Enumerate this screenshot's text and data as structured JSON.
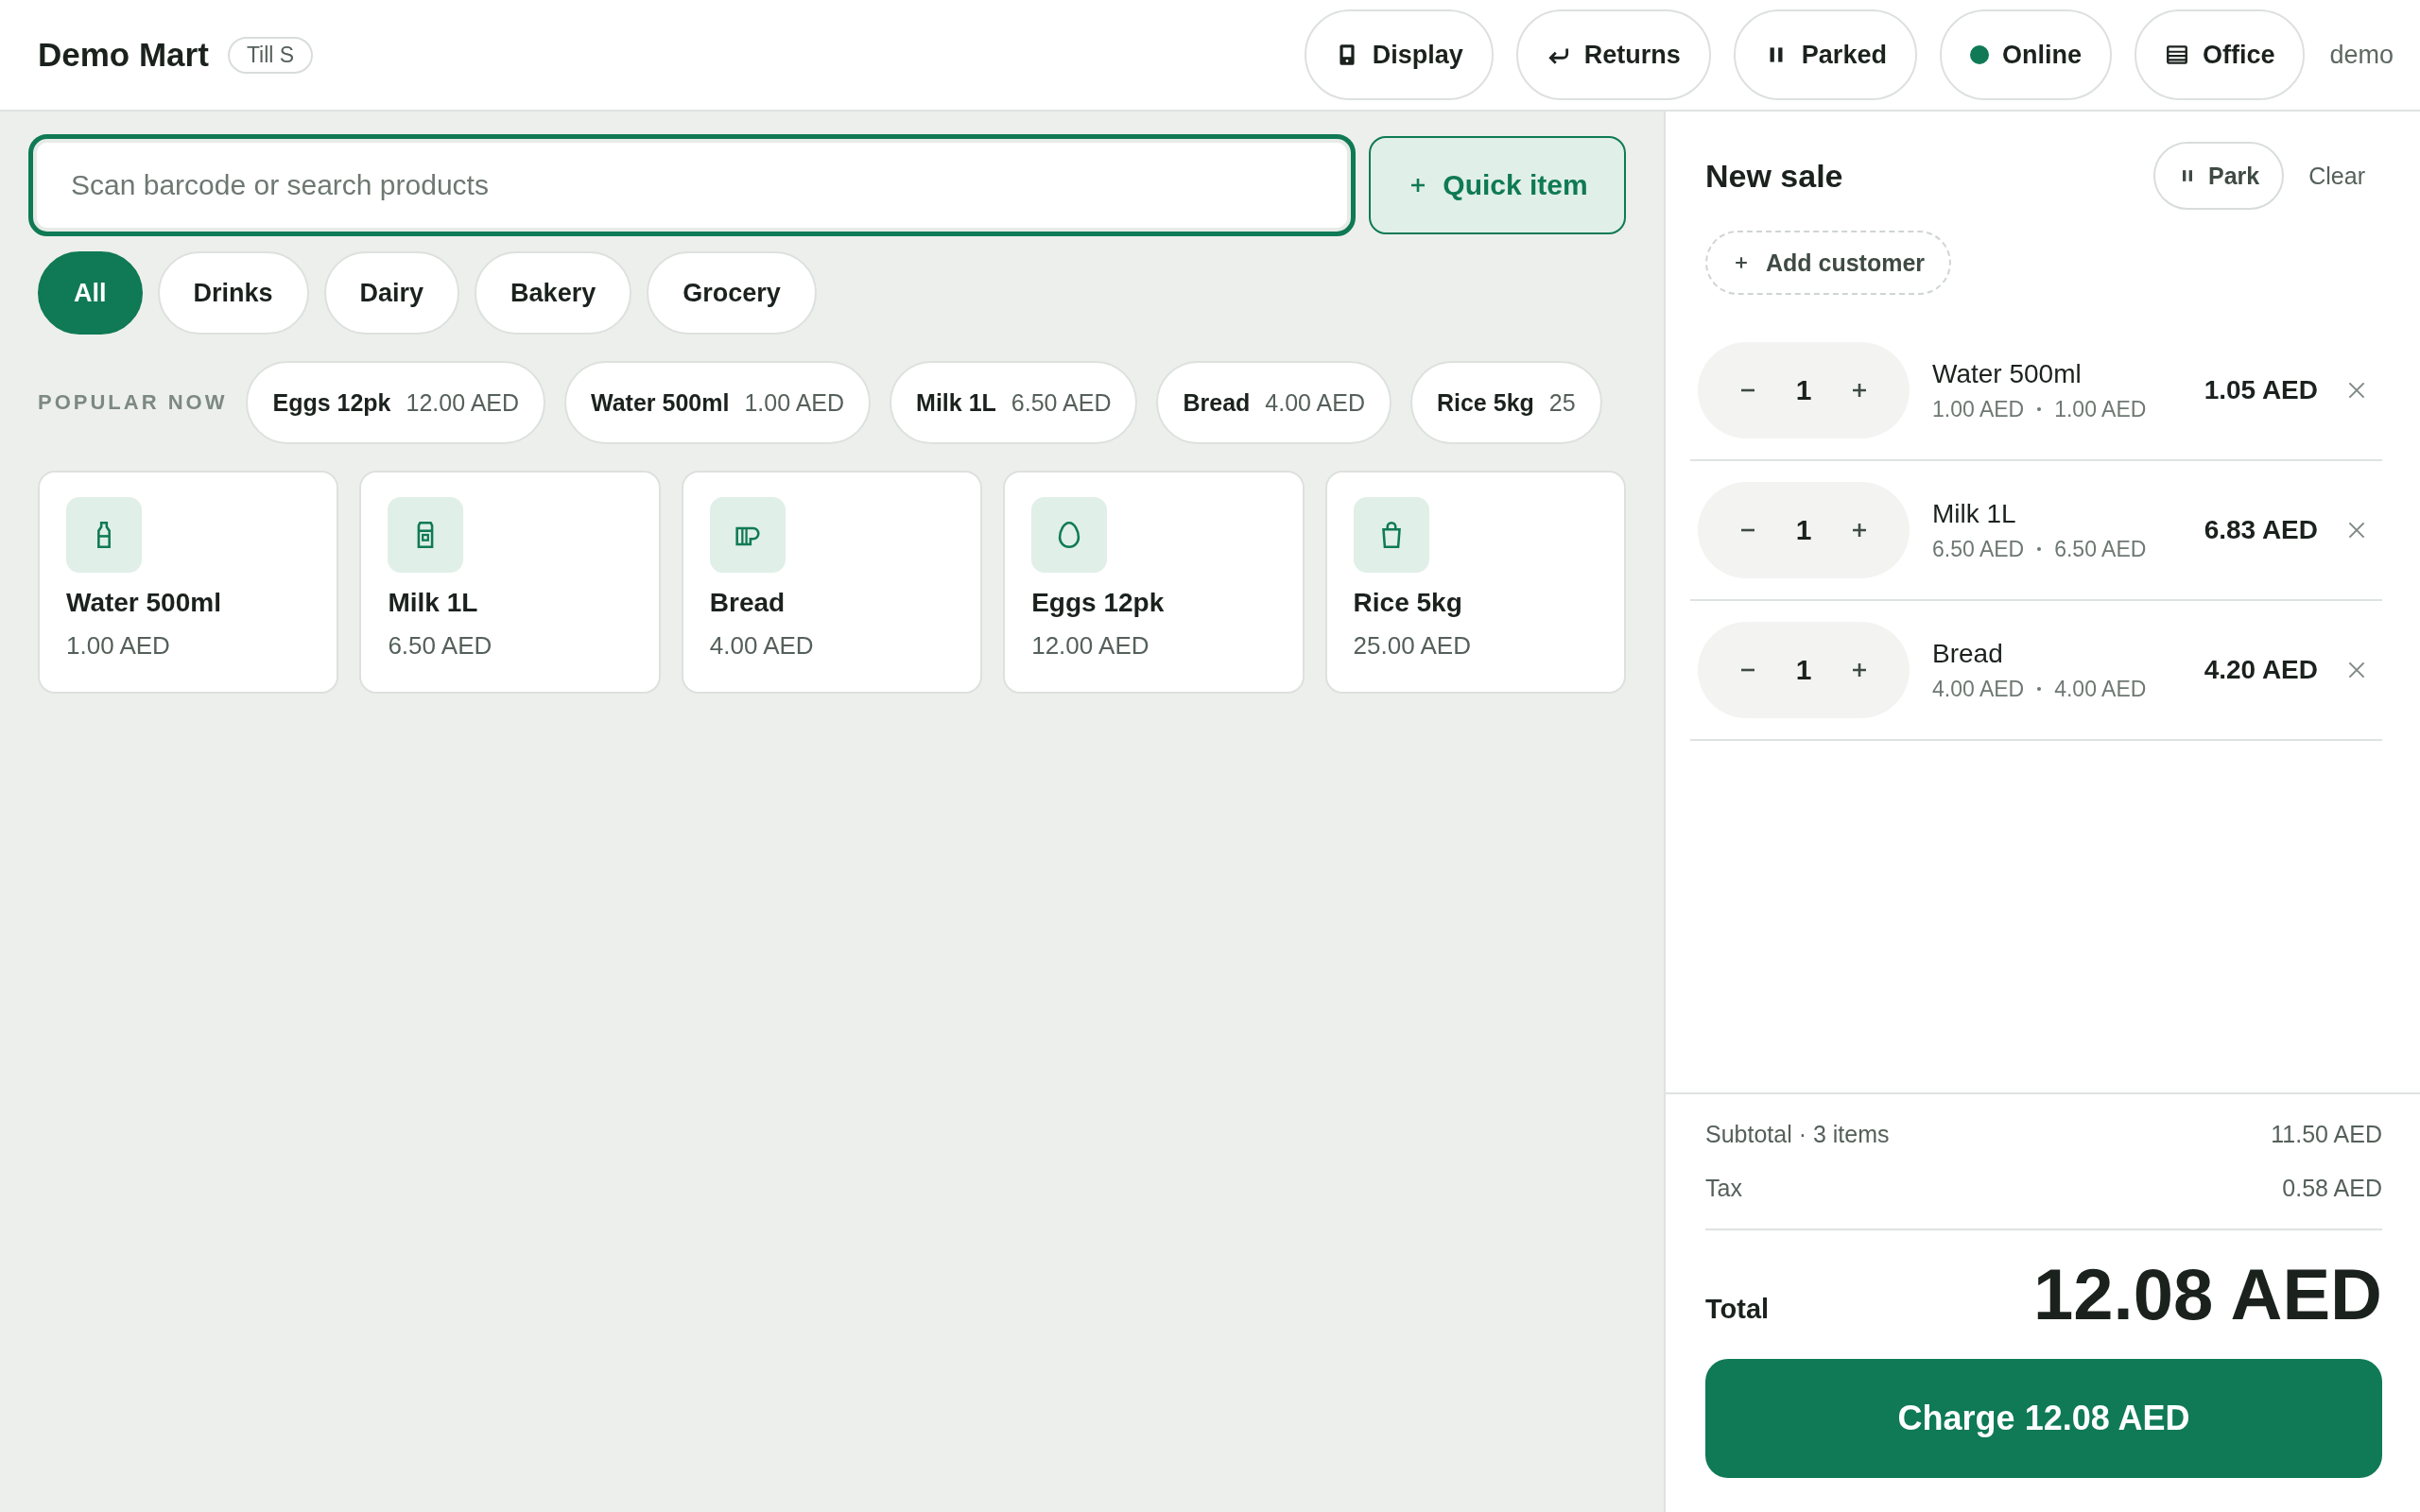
{
  "header": {
    "brand": "Demo Mart",
    "till": "Till S",
    "actions": [
      {
        "kind": "display",
        "label": "Display"
      },
      {
        "kind": "returns",
        "label": "Returns"
      },
      {
        "kind": "parked",
        "label": "Parked"
      },
      {
        "kind": "status",
        "label": "Online",
        "color": "#0f7a55"
      },
      {
        "kind": "office",
        "label": "Office"
      }
    ],
    "user": "demo"
  },
  "search": {
    "placeholder": "Scan barcode or search products"
  },
  "quick_item": {
    "label": "Quick item"
  },
  "categories": [
    {
      "label": "All",
      "selected": true
    },
    {
      "label": "Drinks",
      "selected": false
    },
    {
      "label": "Dairy",
      "selected": false
    },
    {
      "label": "Bakery",
      "selected": false
    },
    {
      "label": "Grocery",
      "selected": false
    }
  ],
  "popular": {
    "label": "POPULAR NOW",
    "items": [
      {
        "name": "Eggs 12pk",
        "price": "12.00 AED"
      },
      {
        "name": "Water 500ml",
        "price": "1.00 AED"
      },
      {
        "name": "Milk 1L",
        "price": "6.50 AED"
      },
      {
        "name": "Bread",
        "price": "4.00 AED"
      },
      {
        "name": "Rice 5kg",
        "price": "25"
      }
    ]
  },
  "products": [
    {
      "kind": "bottle",
      "name": "Water 500ml",
      "price": "1.00 AED"
    },
    {
      "kind": "carton",
      "name": "Milk 1L",
      "price": "6.50 AED"
    },
    {
      "kind": "loaf",
      "name": "Bread",
      "price": "4.00 AED"
    },
    {
      "kind": "egg",
      "name": "Eggs 12pk",
      "price": "12.00 AED"
    },
    {
      "kind": "bag",
      "name": "Rice 5kg",
      "price": "25.00 AED"
    }
  ],
  "cart": {
    "title": "New sale",
    "park": "Park",
    "clear": "Clear",
    "add_customer": "Add customer",
    "lines": [
      {
        "qty": "1",
        "name": "Water 500ml",
        "unit_price": "1.00 AED",
        "line_price": "1.00 AED",
        "total": "1.05 AED"
      },
      {
        "qty": "1",
        "name": "Milk 1L",
        "unit_price": "6.50 AED",
        "line_price": "6.50 AED",
        "total": "6.83 AED"
      },
      {
        "qty": "1",
        "name": "Bread",
        "unit_price": "4.00 AED",
        "line_price": "4.00 AED",
        "total": "4.20 AED"
      }
    ],
    "subtotal_label": "Subtotal · 3 items",
    "subtotal": "11.50 AED",
    "tax_label": "Tax",
    "tax": "0.58 AED",
    "total_label": "Total",
    "total": "12.08 AED",
    "charge": "Charge 12.08 AED"
  }
}
